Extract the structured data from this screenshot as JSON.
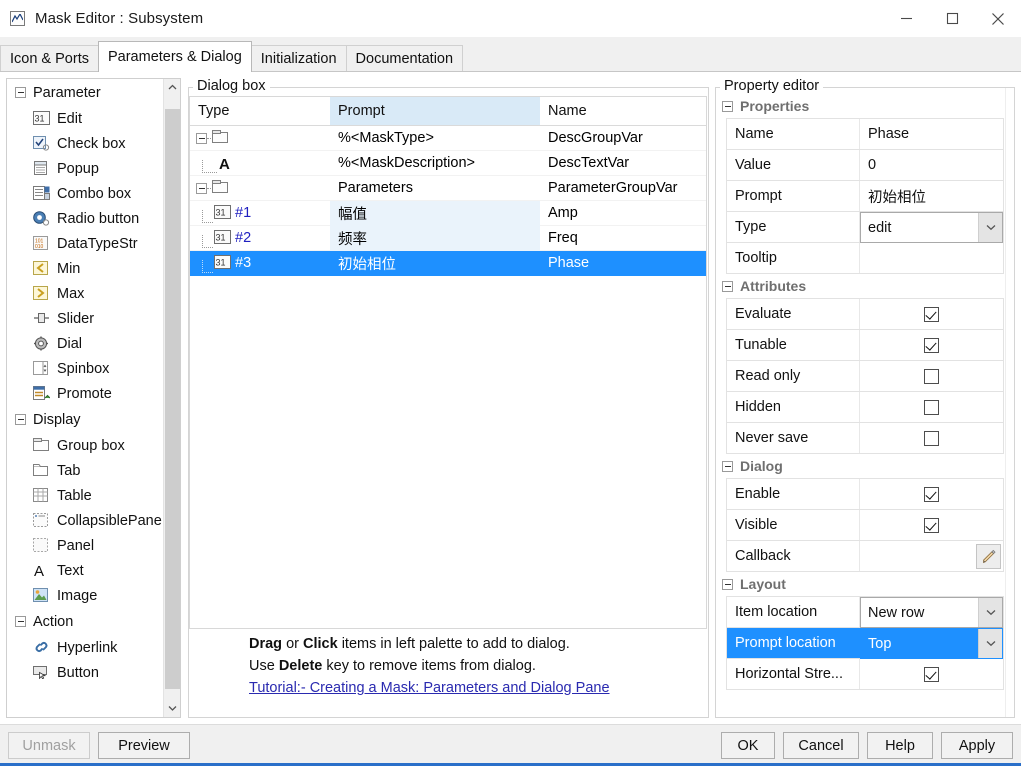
{
  "window": {
    "title": "Mask Editor : Subsystem",
    "icon": "matlab-mask-icon",
    "controls": {
      "minimize": "minimize-icon",
      "maximize": "maximize-icon",
      "close": "close-icon"
    }
  },
  "tabs": [
    {
      "label": "Icon & Ports",
      "active": false
    },
    {
      "label": "Parameters & Dialog",
      "active": true
    },
    {
      "label": "Initialization",
      "active": false
    },
    {
      "label": "Documentation",
      "active": false
    }
  ],
  "palette": {
    "groups": [
      {
        "label": "Parameter",
        "items": [
          {
            "label": "Edit",
            "icon": "edit-field-icon"
          },
          {
            "label": "Check box",
            "icon": "check-box-icon"
          },
          {
            "label": "Popup",
            "icon": "popup-list-icon"
          },
          {
            "label": "Combo box",
            "icon": "combo-box-icon"
          },
          {
            "label": "Radio button",
            "icon": "radio-button-icon"
          },
          {
            "label": "DataTypeStr",
            "icon": "datatype-string-icon"
          },
          {
            "label": "Min",
            "icon": "min-icon"
          },
          {
            "label": "Max",
            "icon": "max-icon"
          },
          {
            "label": "Slider",
            "icon": "slider-icon"
          },
          {
            "label": "Dial",
            "icon": "dial-icon"
          },
          {
            "label": "Spinbox",
            "icon": "spinbox-icon"
          },
          {
            "label": "Promote",
            "icon": "promote-icon"
          }
        ]
      },
      {
        "label": "Display",
        "items": [
          {
            "label": "Group box",
            "icon": "group-box-icon"
          },
          {
            "label": "Tab",
            "icon": "tab-icon"
          },
          {
            "label": "Table",
            "icon": "table-icon"
          },
          {
            "label": "CollapsiblePane",
            "icon": "collapsible-panel-icon"
          },
          {
            "label": "Panel",
            "icon": "panel-icon"
          },
          {
            "label": "Text",
            "icon": "text-icon"
          },
          {
            "label": "Image",
            "icon": "image-icon"
          }
        ]
      },
      {
        "label": "Action",
        "items": [
          {
            "label": "Hyperlink",
            "icon": "hyperlink-icon"
          },
          {
            "label": "Button",
            "icon": "button-icon"
          }
        ]
      }
    ]
  },
  "dialog_box": {
    "legend": "Dialog box",
    "columns": [
      "Type",
      "Prompt",
      "Name"
    ],
    "rows": [
      {
        "num": "",
        "icon": "group-box-icon",
        "indent": 0,
        "expandable": true,
        "prompt": "%<MaskType>",
        "name": "DescGroupVar",
        "selected": false,
        "alt": false
      },
      {
        "num": "",
        "icon": "text-icon",
        "indent": 1,
        "expandable": false,
        "prompt": "%<MaskDescription>",
        "name": "DescTextVar",
        "selected": false,
        "alt": false
      },
      {
        "num": "",
        "icon": "group-box-icon",
        "indent": 0,
        "expandable": true,
        "prompt": "Parameters",
        "name": "ParameterGroupVar",
        "selected": false,
        "alt": false
      },
      {
        "num": "#1",
        "icon": "edit-field-icon",
        "indent": 1,
        "expandable": false,
        "prompt": "幅值",
        "name": "Amp",
        "selected": false,
        "alt": true
      },
      {
        "num": "#2",
        "icon": "edit-field-icon",
        "indent": 1,
        "expandable": false,
        "prompt": "频率",
        "name": "Freq",
        "selected": false,
        "alt": true
      },
      {
        "num": "#3",
        "icon": "edit-field-icon",
        "indent": 1,
        "expandable": false,
        "prompt": "初始相位",
        "name": "Phase",
        "selected": true,
        "alt": false
      }
    ],
    "hints": {
      "line1_a": "Drag",
      "line1_b": " or ",
      "line1_c": "Click",
      "line1_d": " items in left palette to add to dialog.",
      "line2_a": "Use ",
      "line2_b": "Delete",
      "line2_c": " key to remove items from dialog.",
      "link": "Tutorial:- Creating a Mask: Parameters and Dialog Pane"
    }
  },
  "property_editor": {
    "legend": "Property editor",
    "sections": [
      {
        "title": "Properties",
        "rows": [
          {
            "label": "Name",
            "value": "Phase",
            "control": "text",
            "selected": false
          },
          {
            "label": "Value",
            "value": "0",
            "control": "text",
            "selected": false
          },
          {
            "label": "Prompt",
            "value": "初始相位",
            "control": "text",
            "selected": false
          },
          {
            "label": "Type",
            "value": "edit",
            "control": "combo",
            "selected": false
          },
          {
            "label": "Tooltip",
            "value": "",
            "control": "text",
            "selected": false
          }
        ]
      },
      {
        "title": "Attributes",
        "rows": [
          {
            "label": "Evaluate",
            "value": "checked",
            "control": "checkbox",
            "selected": false
          },
          {
            "label": "Tunable",
            "value": "checked",
            "control": "checkbox",
            "selected": false
          },
          {
            "label": "Read only",
            "value": "unchecked",
            "control": "checkbox",
            "selected": false
          },
          {
            "label": "Hidden",
            "value": "unchecked",
            "control": "checkbox",
            "selected": false
          },
          {
            "label": "Never save",
            "value": "unchecked",
            "control": "checkbox",
            "selected": false
          }
        ]
      },
      {
        "title": "Dialog",
        "rows": [
          {
            "label": "Enable",
            "value": "checked",
            "control": "checkbox",
            "selected": false
          },
          {
            "label": "Visible",
            "value": "checked",
            "control": "checkbox",
            "selected": false
          },
          {
            "label": "Callback",
            "value": "",
            "control": "pencil",
            "selected": false
          }
        ]
      },
      {
        "title": "Layout",
        "rows": [
          {
            "label": "Item location",
            "value": "New row",
            "control": "combo",
            "selected": false
          },
          {
            "label": "Prompt location",
            "value": "Top",
            "control": "combo",
            "selected": true
          },
          {
            "label": "Horizontal Stre...",
            "value": "checked",
            "control": "checkbox",
            "selected": false
          }
        ]
      }
    ]
  },
  "footer": {
    "unmask": "Unmask",
    "preview": "Preview",
    "ok": "OK",
    "cancel": "Cancel",
    "help": "Help",
    "apply": "Apply"
  },
  "colors": {
    "selection_blue": "#1e90ff",
    "header_highlight": "#d9eaf7",
    "alt_row": "#eaf3fb",
    "link": "#2a2ab0",
    "accent_strip": "#2a6fc9"
  }
}
